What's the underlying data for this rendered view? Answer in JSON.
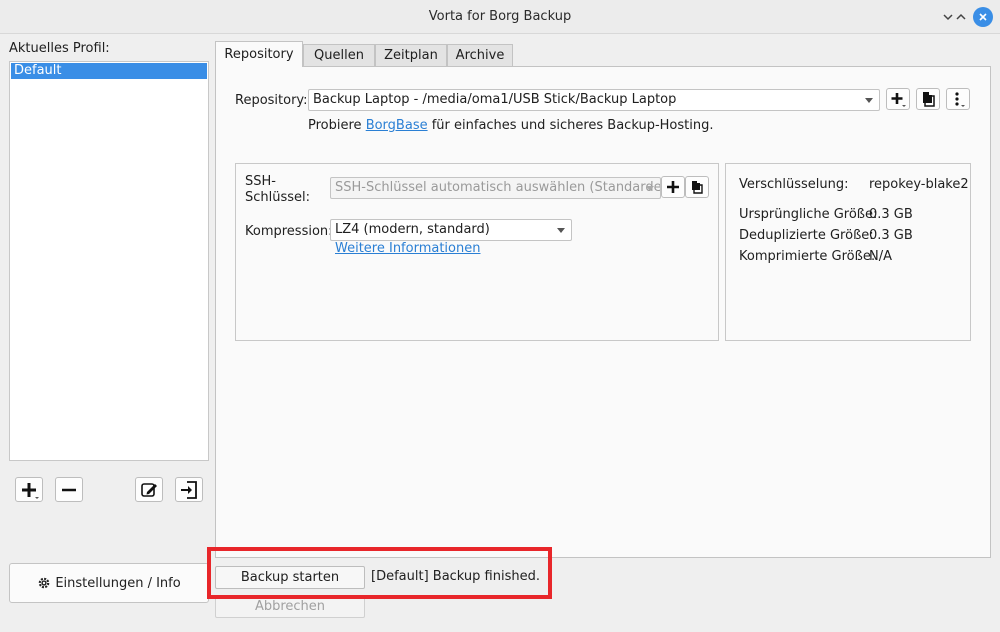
{
  "window": {
    "title": "Vorta for Borg Backup"
  },
  "profiles": {
    "label": "Aktuelles Profil:",
    "items": [
      "Default"
    ]
  },
  "settings_button": {
    "label": "Einstellungen / Info",
    "icon": "gear-icon"
  },
  "tabs": [
    "Repository",
    "Quellen",
    "Zeitplan",
    "Archive"
  ],
  "repository": {
    "label": "Repository:",
    "selected": "Backup Laptop - /media/oma1/USB Stick/Backup Laptop",
    "hint_prefix": "Probiere ",
    "hint_link": "BorgBase",
    "hint_suffix": " für einfaches und sicheres Backup-Hosting."
  },
  "ssh": {
    "label_line1": "SSH-",
    "label_line2": "Schlüssel:",
    "selected": "SSH-Schlüssel automatisch auswählen (Standardeinst"
  },
  "compression": {
    "label": "Kompression:",
    "selected": "LZ4 (modern, standard)",
    "more_info": "Weitere Informationen"
  },
  "info": {
    "rows": [
      {
        "label": "Verschlüsselung:",
        "value": "repokey-blake2"
      },
      {
        "label": "Ursprüngliche Größe:",
        "value": "0.3 GB"
      },
      {
        "label": "Deduplizierte Größe:",
        "value": "0.3 GB"
      },
      {
        "label": "Komprimierte Größe:",
        "value": "N/A"
      }
    ]
  },
  "actions": {
    "backup_start": "Backup starten",
    "abort": "Abbrechen",
    "status": "[Default] Backup finished."
  },
  "colors": {
    "accent": "#3a8ee6",
    "highlight": "#e8262a",
    "link": "#2a7fd4"
  }
}
